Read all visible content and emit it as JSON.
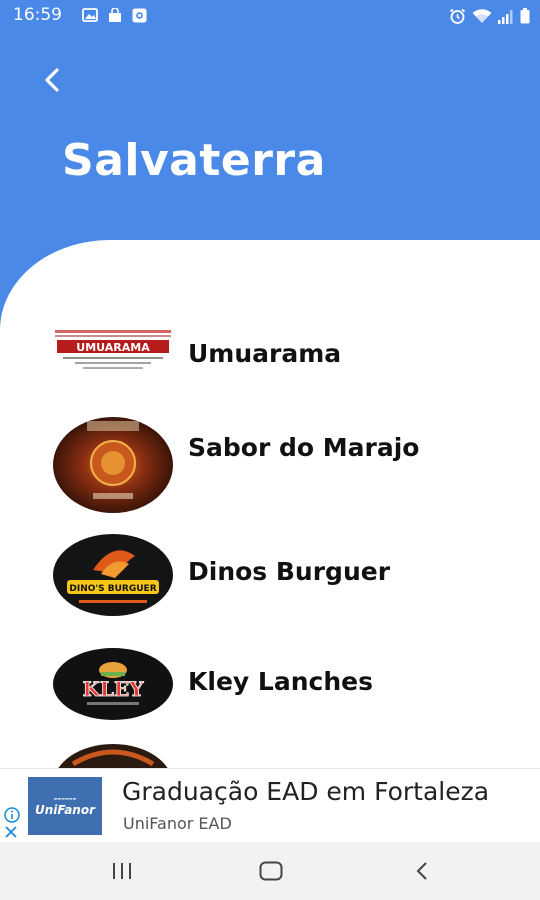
{
  "status_bar": {
    "time": "16:59"
  },
  "header": {
    "title": "Salvaterra",
    "back_icon": "chevron-left-icon"
  },
  "restaurants": [
    {
      "name": "Umuarama",
      "logo_text": "UMUARAMA"
    },
    {
      "name": "Sabor do Marajo",
      "logo_text": ""
    },
    {
      "name": "Dinos Burguer",
      "logo_text": "DINO'S BURGUER"
    },
    {
      "name": "Kley Lanches",
      "logo_text": "KLEY"
    }
  ],
  "ad": {
    "title": "Graduação EAD em Fortaleza",
    "subtitle": "UniFanor EAD",
    "logo_text": "UniFanor",
    "close_icon": "close-icon",
    "info_icon": "info-icon"
  },
  "colors": {
    "primary": "#4a89e8",
    "background": "#ffffff",
    "text": "#111111"
  }
}
